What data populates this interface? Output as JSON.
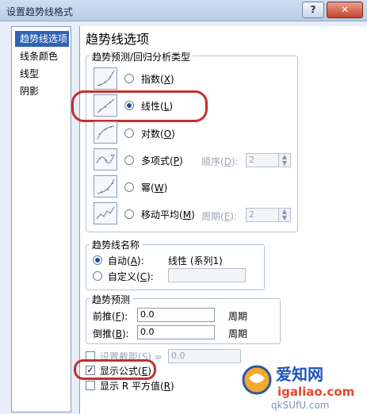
{
  "window": {
    "title": "设置趋势线格式",
    "help": "?",
    "close": "✕"
  },
  "nav": {
    "items": [
      "趋势线选项",
      "线条颜色",
      "线型",
      "阴影"
    ],
    "selected": 0
  },
  "panel": {
    "heading": "趋势线选项",
    "type_group": {
      "label": "趋势预测/回归分析类型",
      "options": [
        {
          "label": "指数",
          "key": "X"
        },
        {
          "label": "线性",
          "key": "L",
          "selected": true
        },
        {
          "label": "对数",
          "key": "O"
        },
        {
          "label": "多项式",
          "key": "P"
        },
        {
          "label": "幂",
          "key": "W"
        },
        {
          "label": "移动平均",
          "key": "M"
        }
      ],
      "order_label": "顺序",
      "order_key": "D",
      "order_value": "2",
      "period_label": "周期",
      "period_key": "E",
      "period_value": "2"
    },
    "name_group": {
      "label": "趋势线名称",
      "auto_label": "自动",
      "auto_key": "A",
      "auto_value": "线性 (系列1)",
      "custom_label": "自定义",
      "custom_key": "C",
      "selected": "auto"
    },
    "forecast_group": {
      "label": "趋势预测",
      "forward_label": "前推",
      "forward_key": "F",
      "forward_value": "0.0",
      "forward_unit": "周期",
      "backward_label": "倒推",
      "backward_key": "B",
      "backward_value": "0.0",
      "backward_unit": "周期"
    },
    "options": {
      "intercept_label": "设置截距",
      "intercept_key": "S",
      "intercept_eq": "=",
      "intercept_value": "0.0",
      "intercept_checked": false,
      "show_equation_label": "显示公式",
      "show_equation_key": "E",
      "show_equation_checked": true,
      "show_r2_label": "显示 R 平方值",
      "show_r2_key": "R",
      "show_r2_checked": false
    }
  },
  "watermark": {
    "logo_text": "爱知网",
    "url": "igaliao.com",
    "bottom": "qkSUfU.com"
  }
}
